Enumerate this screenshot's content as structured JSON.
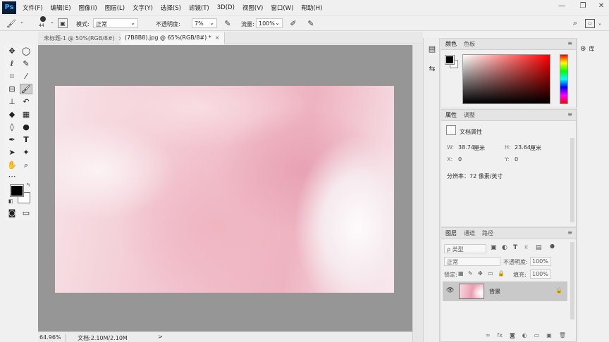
{
  "app": {
    "logo": "Ps",
    "menu": [
      "文件(F)",
      "编辑(E)",
      "图像(I)",
      "图层(L)",
      "文字(Y)",
      "选择(S)",
      "滤镜(T)",
      "3D(D)",
      "视图(V)",
      "窗口(W)",
      "帮助(H)"
    ],
    "window_controls": [
      "—",
      "❐",
      "✕"
    ]
  },
  "options": {
    "brush_size": "44",
    "mode_label": "模式:",
    "mode_value": "正常",
    "opacity_label": "不透明度:",
    "opacity_value": "7%",
    "flow_label": "流量:",
    "flow_value": "100%"
  },
  "tabs": [
    {
      "label": "未标题-1 @ 50%(RGB/8#)",
      "close": "×"
    },
    {
      "label": "(7B8B8).jpg @ 65%(RGB/8#) *",
      "close": "×"
    }
  ],
  "status": {
    "zoom": "64.96%",
    "doc_info": "文档:2.10M/2.10M",
    "arrow": ">"
  },
  "color_panel": {
    "tabs": [
      "颜色",
      "色板"
    ],
    "menu": "≡",
    "foreground": "#000000",
    "background": "#ffffff"
  },
  "properties_panel": {
    "tabs": [
      "属性",
      "调整"
    ],
    "title": "文档属性",
    "w_label": "W:",
    "w_value": "38.74",
    "w_unit": "厘米",
    "h_label": "H:",
    "h_value": "23.64",
    "h_unit": "厘米",
    "x_label": "X:",
    "x_value": "0",
    "y_label": "Y:",
    "y_value": "0",
    "resolution": "分辨率：72 像素/英寸"
  },
  "layers_panel": {
    "tabs": [
      "图层",
      "通道",
      "路径"
    ],
    "filter_kind": "ρ 类型",
    "blend_mode": "正常",
    "opacity_label": "不透明度:",
    "opacity_value": "100%",
    "lock_label": "锁定:",
    "fill_label": "填充:",
    "fill_value": "100%",
    "layer_name": "背景",
    "footer_icons": [
      "∞",
      "fx",
      "◙",
      "◐",
      "▭",
      "▣",
      "🗑"
    ]
  },
  "libraries": {
    "label": "库"
  },
  "colors": {
    "accent": "#31a8ff",
    "canvas_bg": "#969696",
    "selected_layer": "#c9c9c9"
  }
}
